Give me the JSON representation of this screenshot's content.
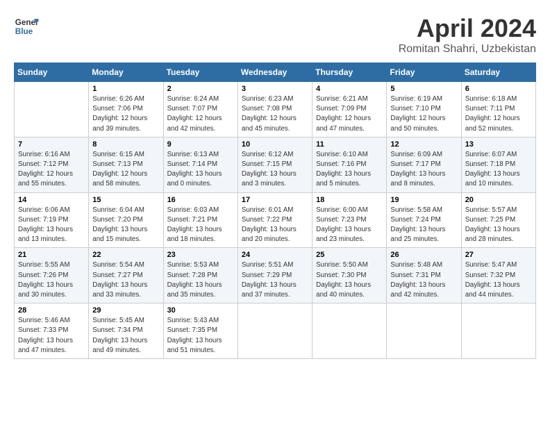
{
  "header": {
    "logo_line1": "General",
    "logo_line2": "Blue",
    "month": "April 2024",
    "location": "Romitan Shahri, Uzbekistan"
  },
  "weekdays": [
    "Sunday",
    "Monday",
    "Tuesday",
    "Wednesday",
    "Thursday",
    "Friday",
    "Saturday"
  ],
  "weeks": [
    [
      {
        "day": "",
        "info": ""
      },
      {
        "day": "1",
        "info": "Sunrise: 6:26 AM\nSunset: 7:06 PM\nDaylight: 12 hours\nand 39 minutes."
      },
      {
        "day": "2",
        "info": "Sunrise: 6:24 AM\nSunset: 7:07 PM\nDaylight: 12 hours\nand 42 minutes."
      },
      {
        "day": "3",
        "info": "Sunrise: 6:23 AM\nSunset: 7:08 PM\nDaylight: 12 hours\nand 45 minutes."
      },
      {
        "day": "4",
        "info": "Sunrise: 6:21 AM\nSunset: 7:09 PM\nDaylight: 12 hours\nand 47 minutes."
      },
      {
        "day": "5",
        "info": "Sunrise: 6:19 AM\nSunset: 7:10 PM\nDaylight: 12 hours\nand 50 minutes."
      },
      {
        "day": "6",
        "info": "Sunrise: 6:18 AM\nSunset: 7:11 PM\nDaylight: 12 hours\nand 52 minutes."
      }
    ],
    [
      {
        "day": "7",
        "info": "Sunrise: 6:16 AM\nSunset: 7:12 PM\nDaylight: 12 hours\nand 55 minutes."
      },
      {
        "day": "8",
        "info": "Sunrise: 6:15 AM\nSunset: 7:13 PM\nDaylight: 12 hours\nand 58 minutes."
      },
      {
        "day": "9",
        "info": "Sunrise: 6:13 AM\nSunset: 7:14 PM\nDaylight: 13 hours\nand 0 minutes."
      },
      {
        "day": "10",
        "info": "Sunrise: 6:12 AM\nSunset: 7:15 PM\nDaylight: 13 hours\nand 3 minutes."
      },
      {
        "day": "11",
        "info": "Sunrise: 6:10 AM\nSunset: 7:16 PM\nDaylight: 13 hours\nand 5 minutes."
      },
      {
        "day": "12",
        "info": "Sunrise: 6:09 AM\nSunset: 7:17 PM\nDaylight: 13 hours\nand 8 minutes."
      },
      {
        "day": "13",
        "info": "Sunrise: 6:07 AM\nSunset: 7:18 PM\nDaylight: 13 hours\nand 10 minutes."
      }
    ],
    [
      {
        "day": "14",
        "info": "Sunrise: 6:06 AM\nSunset: 7:19 PM\nDaylight: 13 hours\nand 13 minutes."
      },
      {
        "day": "15",
        "info": "Sunrise: 6:04 AM\nSunset: 7:20 PM\nDaylight: 13 hours\nand 15 minutes."
      },
      {
        "day": "16",
        "info": "Sunrise: 6:03 AM\nSunset: 7:21 PM\nDaylight: 13 hours\nand 18 minutes."
      },
      {
        "day": "17",
        "info": "Sunrise: 6:01 AM\nSunset: 7:22 PM\nDaylight: 13 hours\nand 20 minutes."
      },
      {
        "day": "18",
        "info": "Sunrise: 6:00 AM\nSunset: 7:23 PM\nDaylight: 13 hours\nand 23 minutes."
      },
      {
        "day": "19",
        "info": "Sunrise: 5:58 AM\nSunset: 7:24 PM\nDaylight: 13 hours\nand 25 minutes."
      },
      {
        "day": "20",
        "info": "Sunrise: 5:57 AM\nSunset: 7:25 PM\nDaylight: 13 hours\nand 28 minutes."
      }
    ],
    [
      {
        "day": "21",
        "info": "Sunrise: 5:55 AM\nSunset: 7:26 PM\nDaylight: 13 hours\nand 30 minutes."
      },
      {
        "day": "22",
        "info": "Sunrise: 5:54 AM\nSunset: 7:27 PM\nDaylight: 13 hours\nand 33 minutes."
      },
      {
        "day": "23",
        "info": "Sunrise: 5:53 AM\nSunset: 7:28 PM\nDaylight: 13 hours\nand 35 minutes."
      },
      {
        "day": "24",
        "info": "Sunrise: 5:51 AM\nSunset: 7:29 PM\nDaylight: 13 hours\nand 37 minutes."
      },
      {
        "day": "25",
        "info": "Sunrise: 5:50 AM\nSunset: 7:30 PM\nDaylight: 13 hours\nand 40 minutes."
      },
      {
        "day": "26",
        "info": "Sunrise: 5:48 AM\nSunset: 7:31 PM\nDaylight: 13 hours\nand 42 minutes."
      },
      {
        "day": "27",
        "info": "Sunrise: 5:47 AM\nSunset: 7:32 PM\nDaylight: 13 hours\nand 44 minutes."
      }
    ],
    [
      {
        "day": "28",
        "info": "Sunrise: 5:46 AM\nSunset: 7:33 PM\nDaylight: 13 hours\nand 47 minutes."
      },
      {
        "day": "29",
        "info": "Sunrise: 5:45 AM\nSunset: 7:34 PM\nDaylight: 13 hours\nand 49 minutes."
      },
      {
        "day": "30",
        "info": "Sunrise: 5:43 AM\nSunset: 7:35 PM\nDaylight: 13 hours\nand 51 minutes."
      },
      {
        "day": "",
        "info": ""
      },
      {
        "day": "",
        "info": ""
      },
      {
        "day": "",
        "info": ""
      },
      {
        "day": "",
        "info": ""
      }
    ]
  ]
}
